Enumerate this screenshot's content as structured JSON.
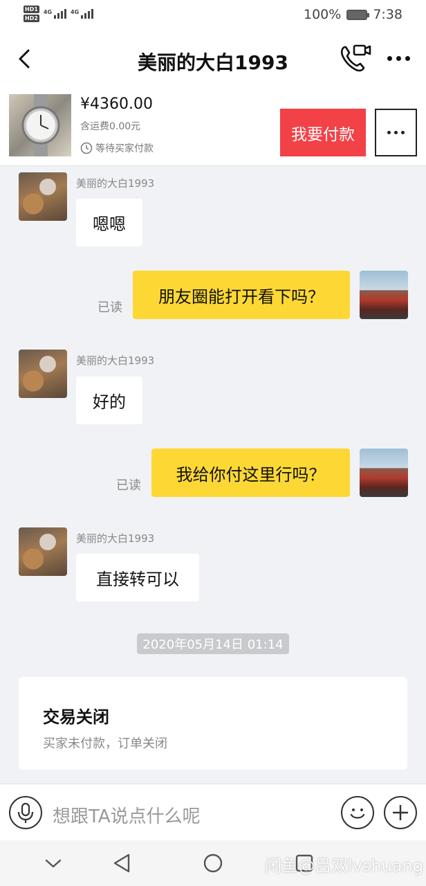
{
  "status_bar": {
    "hd_badges": [
      "HD1",
      "HD2"
    ],
    "network_labels": [
      "4G",
      "4G"
    ],
    "battery_percent": "100%",
    "time": "7:38"
  },
  "header": {
    "title": "美丽的大白1993"
  },
  "order": {
    "price": "¥4360.00",
    "shipping": "含运费0.00元",
    "status": "等待买家付款",
    "pay_label": "我要付款"
  },
  "messages": [
    {
      "side": "in",
      "nickname": "美丽的大白1993",
      "text": "嗯嗯"
    },
    {
      "side": "out",
      "read_label": "已读",
      "text": "朋友圈能打开看下吗？"
    },
    {
      "side": "in",
      "nickname": "美丽的大白1993",
      "text": "好的"
    },
    {
      "side": "out",
      "read_label": "已读",
      "text": "我给你付这里行吗？"
    },
    {
      "side": "in",
      "nickname": "美丽的大白1993",
      "text": "直接转可以"
    }
  ],
  "timestamp": "2020年05月14日 01:14",
  "system_card": {
    "title": "交易关闭",
    "subtitle": "买家未付款，订单关闭"
  },
  "input": {
    "placeholder": "想跟TA说点什么呢"
  },
  "watermark": "闲鱼@吕双lvshuang",
  "colors": {
    "accent_red": "#f24147",
    "outgoing_bubble": "#fdd835",
    "background": "#f1f2f5"
  },
  "icons": [
    "back-arrow-icon",
    "video-call-icon",
    "more-icon",
    "clock-icon",
    "mic-icon",
    "emoji-icon",
    "plus-icon",
    "nav-down-icon",
    "nav-back-icon",
    "nav-home-icon"
  ]
}
